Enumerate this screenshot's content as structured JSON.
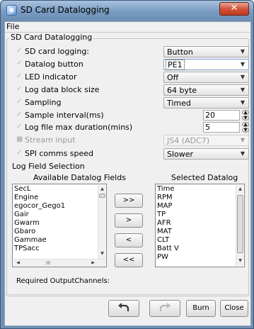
{
  "window": {
    "title": "SD Card Datalogging",
    "close_glyph": "✕"
  },
  "menu": {
    "file": "File"
  },
  "group": {
    "title": "SD Card Datalogging"
  },
  "settings": [
    {
      "label": "SD card logging:",
      "control": "combo",
      "value": "Button"
    },
    {
      "label": "Datalog button",
      "control": "combo",
      "value": "PE1",
      "focused": true
    },
    {
      "label": "LED indicator",
      "control": "combo",
      "value": "Off"
    },
    {
      "label": "Log data block size",
      "control": "combo",
      "value": "64 byte"
    },
    {
      "label": "Sampling",
      "control": "combo",
      "value": "Timed"
    },
    {
      "label": "Sample interval(ms)",
      "control": "spinner",
      "value": "20"
    },
    {
      "label": "Log file max duration(mins)",
      "control": "spinner",
      "value": "5"
    },
    {
      "label": "Stream input",
      "control": "combo",
      "value": "JS4 (ADC7)",
      "disabled": true
    },
    {
      "label": "SPI comms speed",
      "control": "combo",
      "value": "Slower"
    }
  ],
  "log_fields": {
    "title": "Log Field Selection",
    "available_title": "Available Datalog Fields",
    "selected_title": "Selected Datalog Fields",
    "available": [
      "SecL",
      "Engine",
      "egocor_Gego1",
      "Gair",
      "Gwarm",
      "Gbaro",
      "Gammae",
      "TPSacc"
    ],
    "selected": [
      "Time",
      "RPM",
      "MAP",
      "TP",
      "AFR",
      "MAT",
      "CLT",
      "Batt V",
      "PW"
    ]
  },
  "transfer_buttons": {
    "add_all": ">>",
    "add": ">",
    "remove": "<",
    "remove_all": "<<"
  },
  "hscroll_thumb": "III",
  "required_output_label": "Required OutputChannels:",
  "footer": {
    "burn": "Burn",
    "close": "Close"
  }
}
